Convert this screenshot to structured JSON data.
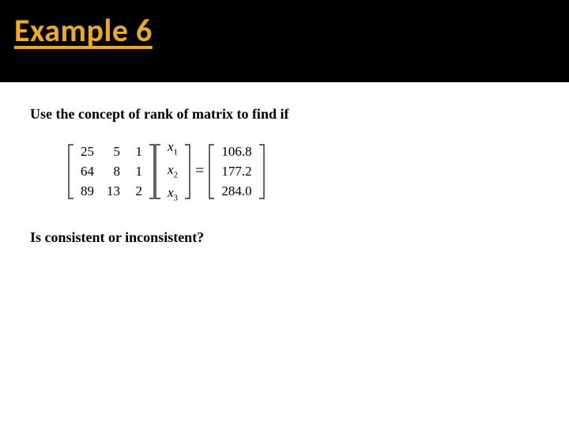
{
  "header": {
    "title": "Example 6"
  },
  "body": {
    "intro": "Use the concept of rank of matrix to find if",
    "question": "Is consistent or inconsistent?"
  },
  "equation": {
    "coef": {
      "r1": {
        "c1": "25",
        "c2": "5",
        "c3": "1"
      },
      "r2": {
        "c1": "64",
        "c2": "8",
        "c3": "1"
      },
      "r3": {
        "c1": "89",
        "c2": "13",
        "c3": "2"
      }
    },
    "vars": {
      "v1": {
        "name": "x",
        "sub": "1"
      },
      "v2": {
        "name": "x",
        "sub": "2"
      },
      "v3": {
        "name": "x",
        "sub": "3"
      }
    },
    "rhs": {
      "b1": "106.8",
      "b2": "177.2",
      "b3": "284.0"
    },
    "equals": "="
  }
}
